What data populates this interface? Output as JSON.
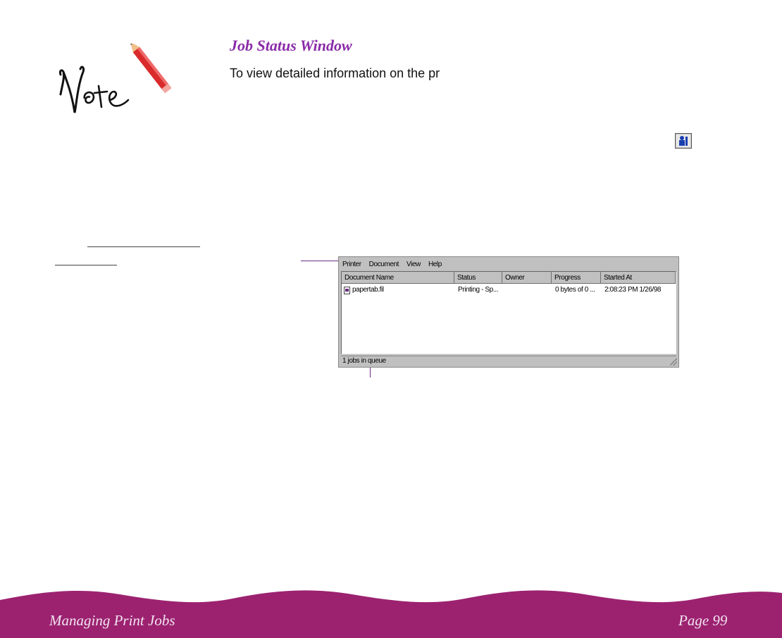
{
  "section": {
    "title": "Job Status Window",
    "intro": "To view detailed information on the pr"
  },
  "window": {
    "menu": [
      "Printer",
      "Document",
      "View",
      "Help"
    ],
    "columns": [
      "Document Name",
      "Status",
      "Owner",
      "Progress",
      "Started At"
    ],
    "rows": [
      {
        "document": "papertab.fil",
        "status": "Printing - Sp...",
        "owner": "",
        "progress": "0 bytes of 0 ...",
        "started": "2:08:23 PM 1/26/98"
      }
    ],
    "status_bar": "1 jobs in queue"
  },
  "icons": {
    "note": "note-pencil-icon",
    "info": "printer-info-icon",
    "document": "document-icon"
  },
  "footer": {
    "left": "Managing Print Jobs",
    "right": "Page 99"
  },
  "colors": {
    "accent": "#8a2aa8",
    "footer_band": "#9c2270"
  }
}
